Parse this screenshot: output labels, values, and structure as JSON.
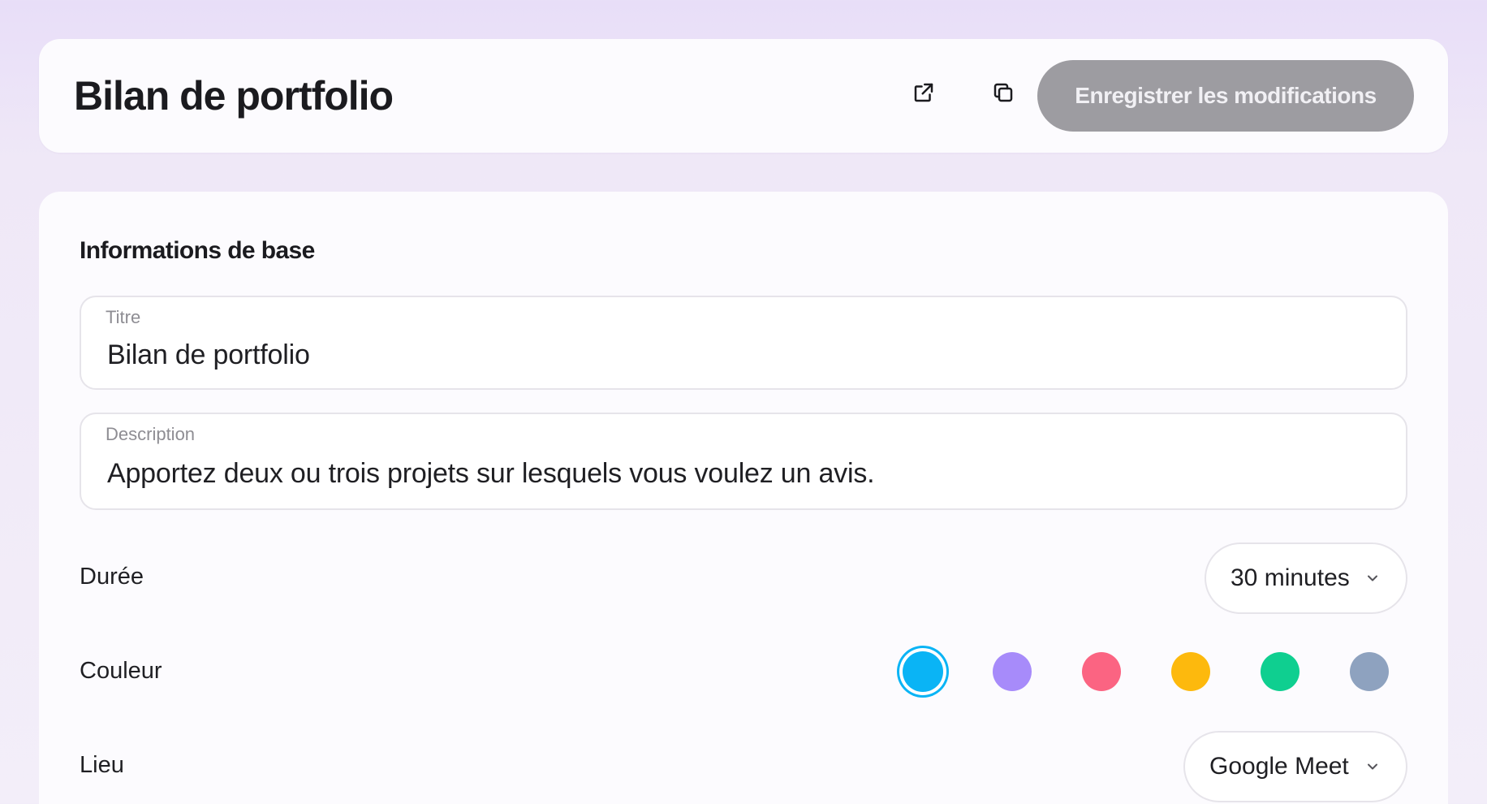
{
  "header": {
    "title": "Bilan de portfolio",
    "open_icon": "external-link-icon",
    "copy_icon": "copy-icon",
    "save_label": "Enregistrer les modifications",
    "save_button_color": "#9d9ca1"
  },
  "basic_info": {
    "section_title": "Informations de base",
    "title_field": {
      "label": "Titre",
      "value": "Bilan de portfolio"
    },
    "description_field": {
      "label": "Description",
      "value": "Apportez deux ou trois projets sur lesquels vous voulez un avis."
    },
    "duration": {
      "label": "Durée",
      "selected": "30 minutes",
      "icon": "chevron-down-icon"
    },
    "color": {
      "label": "Couleur",
      "options": [
        {
          "name": "blue",
          "hex": "#0ab4f5",
          "selected": true
        },
        {
          "name": "purple",
          "hex": "#a78bfa",
          "selected": false
        },
        {
          "name": "pink",
          "hex": "#fb6482",
          "selected": false
        },
        {
          "name": "amber",
          "hex": "#fdb90d",
          "selected": false
        },
        {
          "name": "green",
          "hex": "#0fcf90",
          "selected": false
        },
        {
          "name": "slate",
          "hex": "#8ea2bf",
          "selected": false
        }
      ]
    },
    "location": {
      "label": "Lieu",
      "selected": "Google Meet",
      "icon": "chevron-down-icon"
    }
  }
}
